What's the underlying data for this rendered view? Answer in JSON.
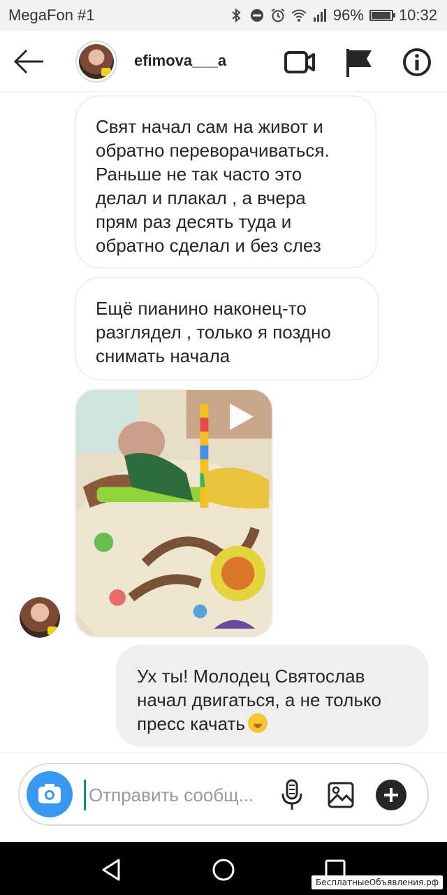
{
  "status_bar": {
    "carrier": "MegaFon #1",
    "battery_percent": "96%",
    "battery_level": 0.96,
    "time": "10:32",
    "icons": [
      "bluetooth-icon",
      "do-not-disturb-icon",
      "alarm-icon",
      "wifi-icon",
      "signal-icon",
      "battery-icon"
    ]
  },
  "header": {
    "username": "efimova___a",
    "icons": [
      "back-arrow-icon",
      "video-call-icon",
      "flag-icon",
      "info-icon"
    ]
  },
  "messages": [
    {
      "direction": "incoming",
      "lines": [
        "Свят начал сам на живот и",
        "обратно переворачиваться.",
        "Раньше не так часто это",
        "делал и плакал , а вчера",
        "прям раз десять туда и",
        "обратно сделал и без слез"
      ]
    },
    {
      "direction": "incoming",
      "lines": [
        "Ещё пианино наконец-то",
        "разглядел , только я поздно",
        "снимать начала"
      ]
    },
    {
      "direction": "incoming",
      "type": "video",
      "icons": [
        "play-icon"
      ]
    },
    {
      "direction": "outgoing",
      "lines": [
        "Ух ты! Молодец Святослав",
        "начал двигаться, а не только",
        "пресс качать"
      ],
      "emoji": "hand-over-mouth-emoji"
    }
  ],
  "composer": {
    "placeholder": "Отправить сообщ...",
    "icons": [
      "camera-icon",
      "microphone-icon",
      "gallery-icon",
      "plus-icon"
    ]
  },
  "nav_bar": {
    "icons": [
      "nav-back-icon",
      "nav-home-icon",
      "nav-recent-icon"
    ]
  },
  "watermark": "БесплатныеОбъявления.рф",
  "colors": {
    "accent": "#3897f0",
    "outgoing_bubble": "#efefef",
    "incoming_border": "#efefef",
    "text": "#262626",
    "cursor": "#0d8f76"
  }
}
